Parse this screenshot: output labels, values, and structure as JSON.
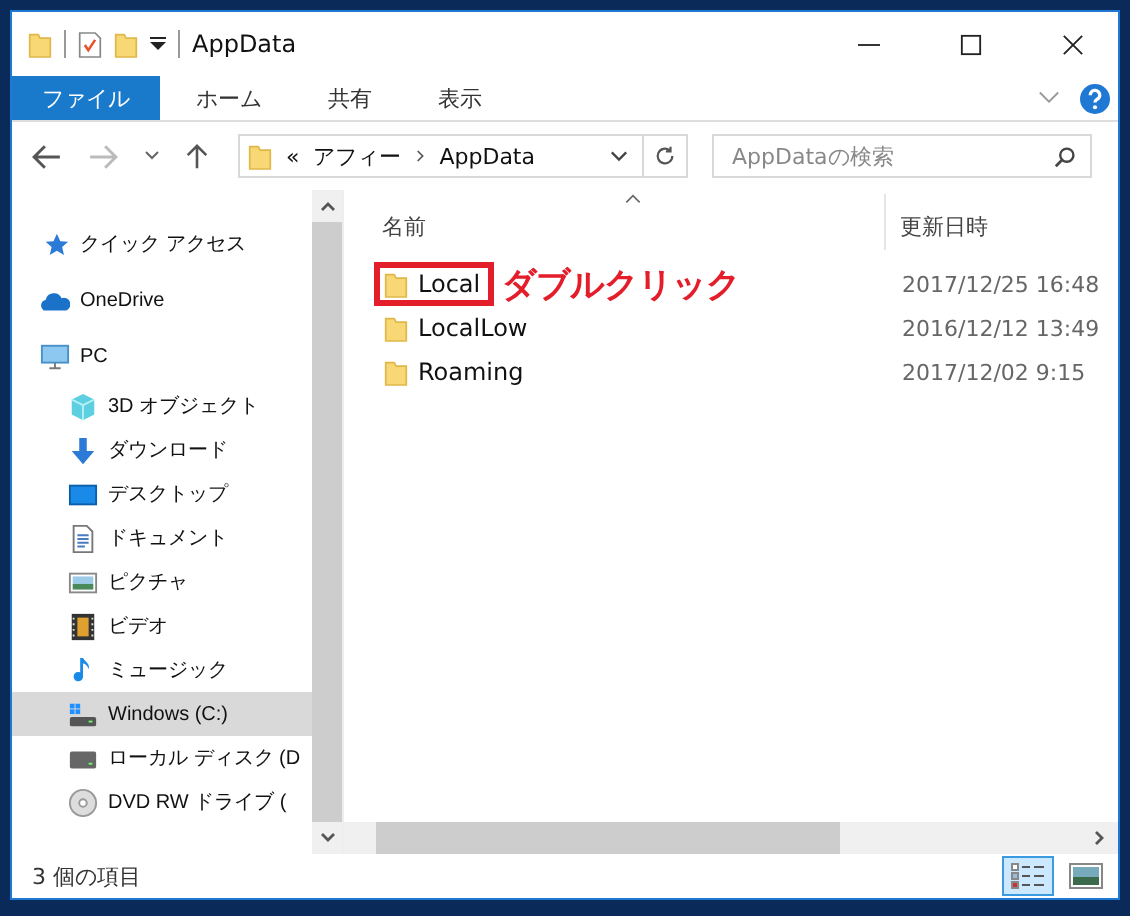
{
  "window": {
    "title": "AppData"
  },
  "ribbon": {
    "tabs": [
      {
        "label": "ファイル",
        "selected": true
      },
      {
        "label": "ホーム",
        "selected": false
      },
      {
        "label": "共有",
        "selected": false
      },
      {
        "label": "表示",
        "selected": false
      }
    ]
  },
  "address": {
    "overflow": "«",
    "path": [
      "アフィー",
      "AppData"
    ]
  },
  "search": {
    "placeholder": "AppDataの検索"
  },
  "sidebar": {
    "items": [
      {
        "label": "クイック アクセス",
        "kind": "star",
        "selected": false
      },
      {
        "label": "OneDrive",
        "kind": "cloud",
        "selected": false
      },
      {
        "label": "PC",
        "kind": "pc",
        "selected": false,
        "children": [
          {
            "label": "3D オブジェクト",
            "kind": "cube",
            "selected": false
          },
          {
            "label": "ダウンロード",
            "kind": "download",
            "selected": false
          },
          {
            "label": "デスクトップ",
            "kind": "desktop",
            "selected": false
          },
          {
            "label": "ドキュメント",
            "kind": "document",
            "selected": false
          },
          {
            "label": "ピクチャ",
            "kind": "picture",
            "selected": false
          },
          {
            "label": "ビデオ",
            "kind": "video",
            "selected": false
          },
          {
            "label": "ミュージック",
            "kind": "music",
            "selected": false
          },
          {
            "label": "Windows (C:)",
            "kind": "windrive",
            "selected": true
          },
          {
            "label": "ローカル ディスク (D",
            "kind": "drive",
            "selected": false
          },
          {
            "label": "DVD RW ドライブ (",
            "kind": "dvd",
            "selected": false
          }
        ]
      }
    ]
  },
  "table": {
    "columns": [
      "名前",
      "更新日時"
    ],
    "rows": [
      {
        "name": "Local",
        "modified": "2017/12/25 16:48",
        "annotation": "ダブルクリック"
      },
      {
        "name": "LocalLow",
        "modified": "2016/12/12 13:49"
      },
      {
        "name": "Roaming",
        "modified": "2017/12/02 9:15"
      }
    ]
  },
  "status_bar": {
    "text": "3 個の項目",
    "views": [
      {
        "kind": "details",
        "selected": true
      },
      {
        "kind": "large",
        "selected": false
      }
    ]
  }
}
